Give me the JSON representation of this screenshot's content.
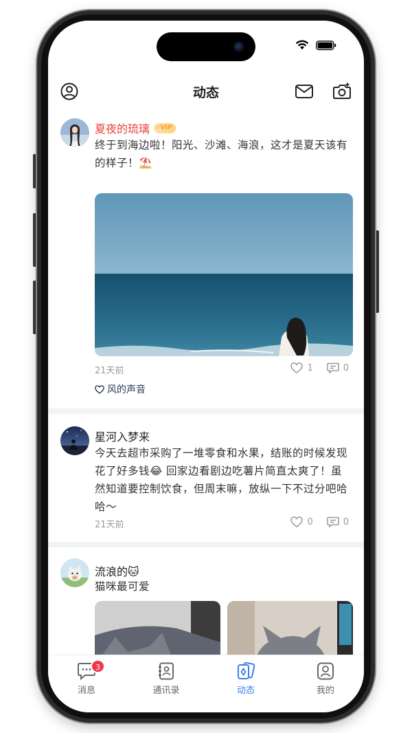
{
  "status_bar": {
    "wifi_icon": "wifi-icon",
    "battery_icon": "battery-icon"
  },
  "header": {
    "title": "动态",
    "left_icon": "profile-circle-icon",
    "right_icons": [
      "mail-icon",
      "camera-icon"
    ]
  },
  "posts": [
    {
      "username": "夏夜的琉璃",
      "vip_label": "VIP",
      "text": "终于到海边啦！阳光、沙滩、海浪，这才是夏天该有的样子！⛱️",
      "image": "beach-photo",
      "time": "21天前",
      "like_count": "1",
      "comment_count": "0",
      "liked_by": "风的声音"
    },
    {
      "username": "星河入梦来",
      "text": "今天去超市采购了一堆零食和水果，结账的时候发现花了好多钱😂 回家边看剧边吃薯片简直太爽了！虽然知道要控制饮食，但周末嘛，放纵一下不过分吧哈哈～",
      "time": "21天前",
      "like_count": "0",
      "comment_count": "0"
    },
    {
      "username": "流浪的🐱",
      "text": "猫咪最可爱",
      "images": [
        "cat-photo-1",
        "cat-photo-2"
      ]
    }
  ],
  "tabbar": {
    "tabs": [
      {
        "label": "消息",
        "icon": "chat-bubble-icon",
        "badge": "3"
      },
      {
        "label": "通讯录",
        "icon": "contacts-book-icon"
      },
      {
        "label": "动态",
        "icon": "cards-icon",
        "active": true
      },
      {
        "label": "我的",
        "icon": "user-square-icon"
      }
    ]
  },
  "colors": {
    "accent": "#3b7cf0",
    "username_highlight": "#e8423a",
    "badge": "#f2354b"
  }
}
